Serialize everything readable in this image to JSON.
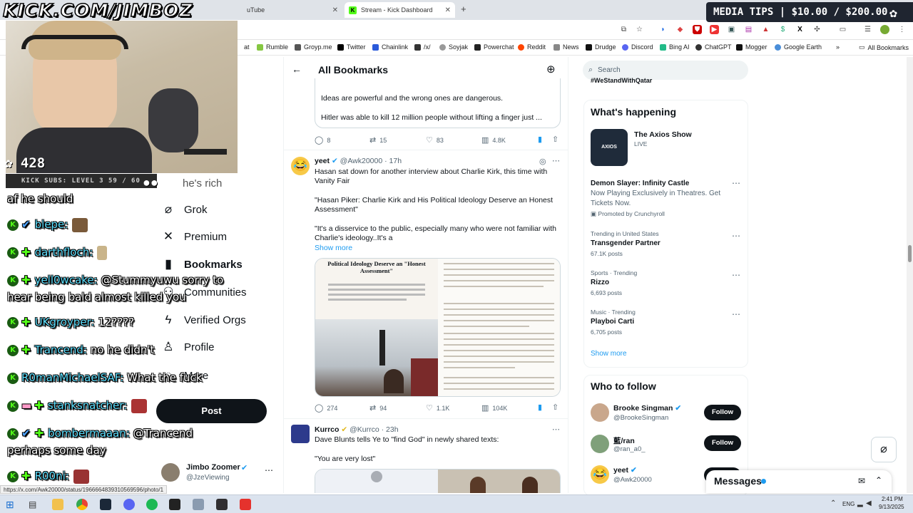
{
  "overlay": {
    "title": "KICK.COM/JIMBOZ",
    "media_tips": "MEDIA TIPS | $10.00 / $200.00",
    "viewer_count": "428",
    "subs_label": "KICK SUBS: LEVEL 3 59 / 60"
  },
  "chat": [
    {
      "user": "",
      "text": "af he should"
    },
    {
      "user": "blepe:",
      "text": ""
    },
    {
      "user": "darthfloch:",
      "text": ""
    },
    {
      "user": "yell0wcake:",
      "text": "@Stummyuwu sorry to"
    },
    {
      "user": "",
      "text": "hear being bald almost killed you"
    },
    {
      "user": "UKgroyper:",
      "text": "12????"
    },
    {
      "user": "Trancend:",
      "text": "no he didn't"
    },
    {
      "user": "R0manMichaelSAF:",
      "text": "What the fuck"
    },
    {
      "user": "stanksnatcher:",
      "text": ""
    },
    {
      "user": "bombermaaan:",
      "text": "@Trancend"
    },
    {
      "user": "",
      "text": "perhaps some day"
    },
    {
      "user": "R00ni:",
      "text": ""
    }
  ],
  "browser": {
    "tabs": [
      {
        "label": "uTube"
      },
      {
        "label": "Stream - Kick Dashboard"
      }
    ],
    "new_tab": "+",
    "bookmarks": [
      "at",
      "Rumble",
      "Groyp.me",
      "Twitter",
      "Chainlink",
      "/x/",
      "Soyjak",
      "Powerchat",
      "Reddit",
      "News",
      "Drudge",
      "Discord",
      "Bing AI",
      "ChatGPT",
      "Mogger",
      "Google Earth"
    ],
    "all_bookmarks": "All Bookmarks",
    "status_url": "https://x.com/Awk20000/status/1966664839310569596/photo/1"
  },
  "nav": {
    "partial_top": "he's rich",
    "items": [
      {
        "label": "Grok",
        "icon": "grok-icon"
      },
      {
        "label": "Premium",
        "icon": "x-logo-icon"
      },
      {
        "label": "Bookmarks",
        "icon": "bookmark-icon"
      },
      {
        "label": "Communities",
        "icon": "communities-icon"
      },
      {
        "label": "Verified Orgs",
        "icon": "lightning-icon"
      },
      {
        "label": "Profile",
        "icon": "person-icon"
      },
      {
        "label": "More",
        "icon": "more-icon"
      }
    ],
    "post_label": "Post",
    "account_name": "Jimbo Zoomer",
    "account_handle": "@JzeViewing"
  },
  "timeline": {
    "title": "All Bookmarks",
    "tweet1": {
      "line1": "Ideas are powerful and the wrong ones are dangerous.",
      "line2": "Hitler was able to kill 12 million people without lifting a finger just ...",
      "replies": "8",
      "reposts": "15",
      "likes": "83",
      "views": "4.8K"
    },
    "tweet2": {
      "name": "yeet",
      "handle": "@Awk20000",
      "time": "· 17h",
      "text1": "Hasan sat down for another interview about Charlie Kirk, this time with",
      "text2": "Vanity Fair",
      "quote1": "\"Hasan Piker: Charlie Kirk and His Political Ideology Deserve an Honest",
      "quote2": "Assessment\"",
      "quote3": "\"It's a disservice to the public, especially many who were not familiar with",
      "quote4": "Charlie's ideology..It's a",
      "show_more": "Show more",
      "image_headline": "Political Ideology Deserve an \"Honest Assessment\"",
      "replies": "274",
      "reposts": "94",
      "likes": "1.1K",
      "views": "104K"
    },
    "tweet3": {
      "name": "Kurrco",
      "handle": "@Kurrco",
      "time": "· 23h",
      "text1": "Dave Blunts tells Ye to \"find God\" in newly shared texts:",
      "text2": "\"You are very lost\""
    }
  },
  "right": {
    "search_placeholder": "Search",
    "partial_top": "#WeStandWithQatar",
    "happening_title": "What's happening",
    "axios_title": "The Axios Show",
    "axios_status": "LIVE",
    "trends": [
      {
        "meta": "",
        "name": "Demon Slayer: Infinity Castle",
        "desc1": "Now Playing Exclusively in Theatres. Get",
        "desc2": "Tickets Now.",
        "count": "Promoted by Crunchyroll"
      },
      {
        "meta": "Trending in United States",
        "name": "Transgender Partner",
        "count": "67.1K posts"
      },
      {
        "meta": "Sports · Trending",
        "name": "Rizzo",
        "count": "6,693 posts"
      },
      {
        "meta": "Music · Trending",
        "name": "Playboi Carti",
        "count": "6,705 posts"
      }
    ],
    "show_more": "Show more",
    "who_title": "Who to follow",
    "follow": [
      {
        "name": "Brooke Singman",
        "handle": "@BrookeSingman",
        "button": "Follow"
      },
      {
        "name": "藍/ran",
        "handle": "@ran_a0_",
        "button": "Follow"
      },
      {
        "name": "yeet",
        "handle": "@Awk20000",
        "button": "Follow"
      }
    ],
    "messages": "Messages"
  },
  "taskbar": {
    "lang": "ENG",
    "time": "2:41 PM",
    "date": "9/13/2025"
  },
  "colors": {
    "kick_green": "#53fc18",
    "x_blue": "#1d9bf0",
    "bookmark_blue": "#1d9bf0",
    "text_primary": "#0f1419",
    "text_muted": "#536471"
  }
}
